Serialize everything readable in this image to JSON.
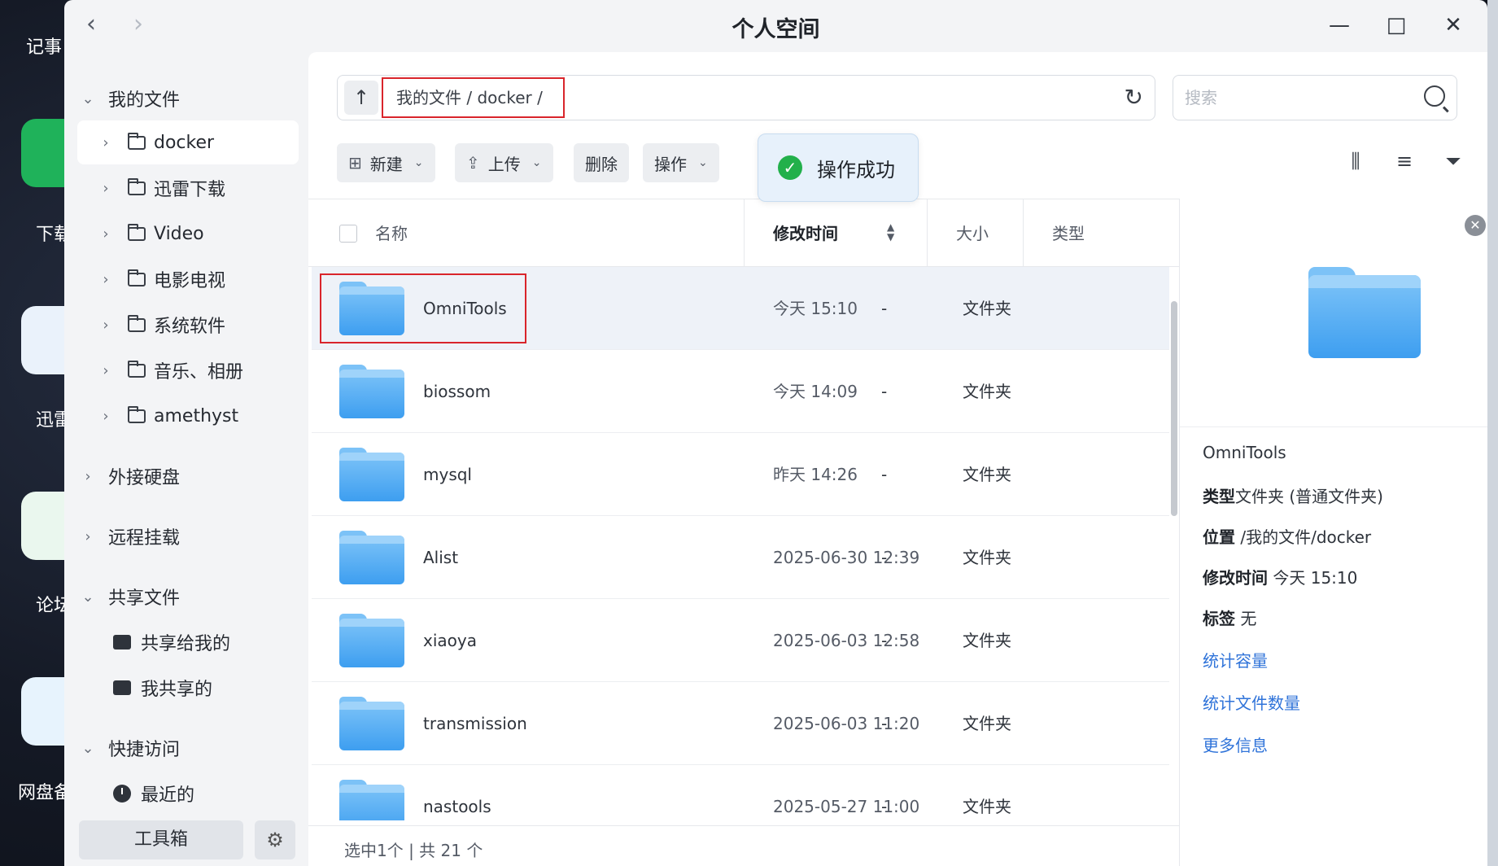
{
  "desktop": {
    "labels": [
      "记事",
      "下载",
      "迅雷",
      "论坛",
      "网盘备"
    ]
  },
  "window": {
    "title": "个人空间"
  },
  "sidebar": {
    "my_files": "我的文件",
    "folders": [
      "docker",
      "迅雷下载",
      "Video",
      "电影电视",
      "系统软件",
      "音乐、相册",
      "amethyst"
    ],
    "external_disk": "外接硬盘",
    "remote_mount": "远程挂载",
    "shared_files": "共享文件",
    "shared_to_me": "共享给我的",
    "my_shared": "我共享的",
    "quick_access": "快捷访问",
    "recent": "最近的",
    "toolbox": "工具箱"
  },
  "pathbar": {
    "path": "我的文件 / docker /",
    "search_placeholder": "搜索"
  },
  "toast": {
    "message": "操作成功"
  },
  "toolbar": {
    "new_label": "新建",
    "upload_label": "上传",
    "delete_label": "删除",
    "actions_label": "操作"
  },
  "table": {
    "headers": {
      "name": "名称",
      "modified": "修改时间",
      "size": "大小",
      "type": "类型"
    },
    "rows": [
      {
        "name": "OmniTools",
        "modified": "今天 15:10",
        "size": "-",
        "type": "文件夹"
      },
      {
        "name": "biossom",
        "modified": "今天 14:09",
        "size": "-",
        "type": "文件夹"
      },
      {
        "name": "mysql",
        "modified": "昨天 14:26",
        "size": "-",
        "type": "文件夹"
      },
      {
        "name": "Alist",
        "modified": "2025-06-30 12:39",
        "size": "-",
        "type": "文件夹"
      },
      {
        "name": "xiaoya",
        "modified": "2025-06-03 12:58",
        "size": "-",
        "type": "文件夹"
      },
      {
        "name": "transmission",
        "modified": "2025-06-03 11:20",
        "size": "-",
        "type": "文件夹"
      },
      {
        "name": "nastools",
        "modified": "2025-05-27 11:00",
        "size": "-",
        "type": "文件夹"
      }
    ]
  },
  "footer": {
    "status": "选中1个 | 共 21 个"
  },
  "details": {
    "name": "OmniTools",
    "type_label": "类型",
    "type_value": "文件夹 (普通文件夹)",
    "location_label": "位置",
    "location_value": "/我的文件/docker",
    "modified_label": "修改时间",
    "modified_value": "今天 15:10",
    "tags_label": "标签",
    "tags_value": "无",
    "calc_size": "统计容量",
    "calc_count": "统计文件数量",
    "more_info": "更多信息"
  },
  "colors": {
    "accent": "#2f73d9",
    "success": "#22b04b",
    "highlight_box": "#d9252b",
    "folder": "#4aa6f2"
  }
}
